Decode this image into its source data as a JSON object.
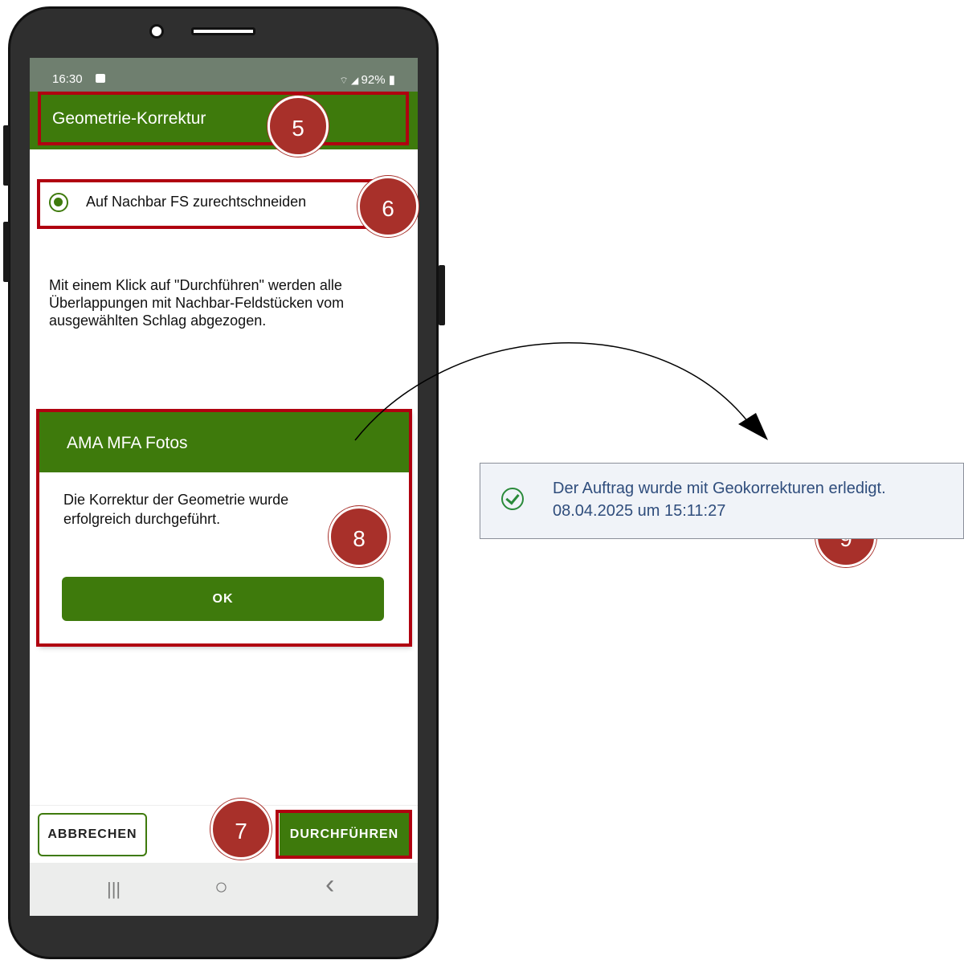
{
  "status_bar": {
    "time": "16:30",
    "right": "92%"
  },
  "app_bar": {
    "title": "Geometrie-Korrektur"
  },
  "option": {
    "label": "Auf Nachbar FS zurechtschneiden"
  },
  "description": "Mit einem Klick auf \"Durchführen\" werden alle Überlappungen mit Nachbar-Feldstücken vom ausgewählten Schlag abgezogen.",
  "dialog": {
    "title": "AMA MFA Fotos",
    "message": "Die Korrektur der Geometrie wurde erfolgreich durchgeführt.",
    "ok_label": "OK"
  },
  "buttons": {
    "cancel": "ABBRECHEN",
    "execute": "DURCHFÜHREN"
  },
  "nav": {
    "recent": "|||",
    "home": "○",
    "back": "‹"
  },
  "notification": {
    "line1": "Der Auftrag wurde mit Geokorrekturen erledigt.",
    "line2": "08.04.2025 um 15:11:27"
  },
  "badges": {
    "b5": "5",
    "b6": "6",
    "b7": "7",
    "b8": "8",
    "b9": "9"
  },
  "colors": {
    "green": "#3e7a0c",
    "annotation_red": "#b00010",
    "badge": "#a8302a"
  }
}
